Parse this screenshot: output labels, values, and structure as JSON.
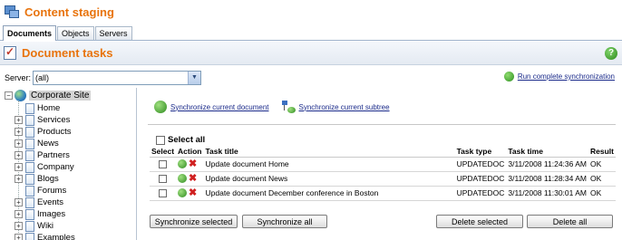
{
  "app": {
    "title": "Content staging"
  },
  "tabs": [
    {
      "label": "Documents",
      "active": true
    },
    {
      "label": "Objects",
      "active": false
    },
    {
      "label": "Servers",
      "active": false
    }
  ],
  "section": {
    "title": "Document tasks",
    "help_icon": "help-icon"
  },
  "server": {
    "label": "Server:",
    "selected": "(all)"
  },
  "run_sync": {
    "label": "Run complete synchronization"
  },
  "tree": {
    "root": "Corporate Site",
    "items": [
      {
        "label": "Home",
        "expandable": false
      },
      {
        "label": "Services",
        "expandable": true
      },
      {
        "label": "Products",
        "expandable": true
      },
      {
        "label": "News",
        "expandable": true
      },
      {
        "label": "Partners",
        "expandable": true
      },
      {
        "label": "Company",
        "expandable": true
      },
      {
        "label": "Blogs",
        "expandable": true
      },
      {
        "label": "Forums",
        "expandable": false
      },
      {
        "label": "Events",
        "expandable": true
      },
      {
        "label": "Images",
        "expandable": true
      },
      {
        "label": "Wiki",
        "expandable": true
      },
      {
        "label": "Examples",
        "expandable": true
      }
    ]
  },
  "links": {
    "sync_current": "Synchronize current document",
    "sync_subtree": "Synchronize current subtree"
  },
  "select_all": "Select all",
  "table": {
    "headers": {
      "select": "Select",
      "action": "Action",
      "title": "Task title",
      "type": "Task type",
      "time": "Task time",
      "result": "Result"
    },
    "rows": [
      {
        "title": "Update document Home",
        "type": "UPDATEDOC",
        "time": "3/11/2008 11:24:36 AM",
        "result": "OK"
      },
      {
        "title": "Update document News",
        "type": "UPDATEDOC",
        "time": "3/11/2008 11:28:34 AM",
        "result": "OK"
      },
      {
        "title": "Update document December conference in Boston",
        "type": "UPDATEDOC",
        "time": "3/11/2008 11:30:01 AM",
        "result": "OK"
      }
    ]
  },
  "buttons": {
    "sync_selected": "Synchronize selected",
    "sync_all": "Synchronize all",
    "delete_selected": "Delete selected",
    "delete_all": "Delete all"
  },
  "colors": {
    "accent": "#e8730c",
    "link": "#1a2a8a"
  }
}
